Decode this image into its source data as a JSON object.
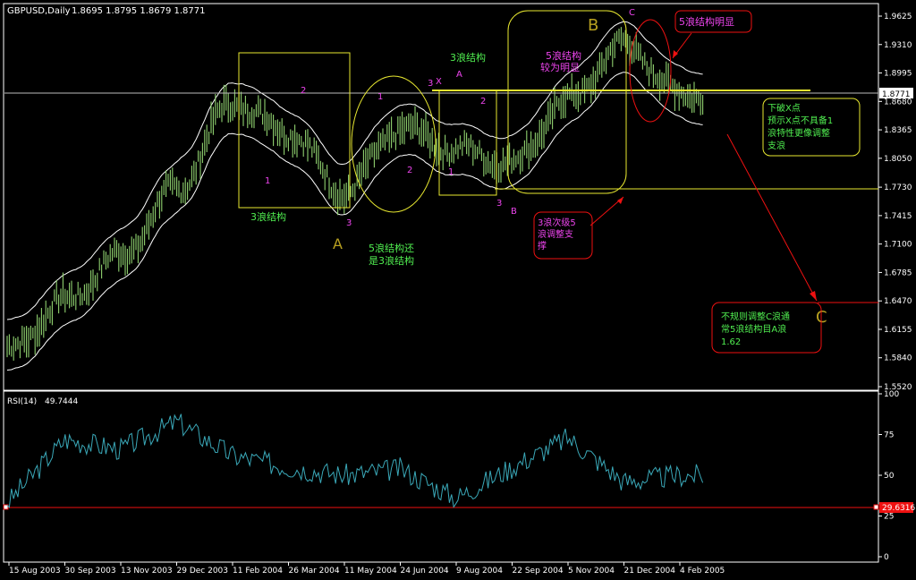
{
  "header": {
    "symbol": "GBPUSD,Daily",
    "ohlc": "1.8695 1.8795 1.8679 1.8771"
  },
  "rsi": {
    "label": "RSI(14)",
    "value": "49.7444",
    "level_label": "29.6316",
    "level": 29.6316,
    "ticks": [
      "100",
      "75",
      "50",
      "25",
      "0"
    ]
  },
  "colors": {
    "background": "#000000",
    "grid_frame": "#ffffff",
    "price_bars": "#8fd16f",
    "bands": "#ffffff",
    "annotation_yellow": "#e8e830",
    "annotation_magenta": "#ee44ee",
    "annotation_green": "#50ee50",
    "annotation_red": "#ee1111",
    "wave_letters": "#b8a020",
    "rsi_line": "#3aa8b8"
  },
  "chart_data": [
    {
      "type": "candlestick",
      "title": "GBPUSD,Daily",
      "price_axis_ticks": [
        "1.9625",
        "1.9310",
        "1.8995",
        "1.8680",
        "1.8365",
        "1.8050",
        "1.7730",
        "1.7415",
        "1.7100",
        "1.6785",
        "1.6470",
        "1.6155",
        "1.5840",
        "1.5520"
      ],
      "current_price_label": "1.8771",
      "ylim": [
        1.552,
        1.9625
      ],
      "date_axis_labels": [
        "15 Aug 2003",
        "30 Sep 2003",
        "13 Nov 2003",
        "29 Dec 2003",
        "11 Feb 2004",
        "26 Mar 2004",
        "11 May 2004",
        "24 Jun 2004",
        "9 Aug 2004",
        "22 Sep 2004",
        "5 Nov 2004",
        "21 Dec 2004",
        "4 Feb 2005"
      ],
      "series": [
        {
          "name": "close (approx.)",
          "x": [
            "15 Aug 2003",
            "30 Sep 2003",
            "13 Nov 2003",
            "29 Dec 2003",
            "11 Feb 2004",
            "26 Mar 2004",
            "11 May 2004",
            "24 Jun 2004",
            "9 Aug 2004",
            "22 Sep 2004",
            "5 Nov 2004",
            "21 Dec 2004",
            "4 Feb 2005"
          ],
          "values": [
            1.592,
            1.647,
            1.697,
            1.771,
            1.867,
            1.835,
            1.768,
            1.838,
            1.815,
            1.8,
            1.869,
            1.931,
            1.877
          ]
        }
      ],
      "horizontal_lines": [
        1.8771,
        1.881,
        1.773,
        1.647
      ]
    },
    {
      "type": "line",
      "title": "RSI(14) 49.7444",
      "ylim": [
        0,
        100
      ],
      "level_line": 29.6316,
      "series": [
        {
          "name": "RSI(14)",
          "x": [
            "15 Aug 2003",
            "30 Sep 2003",
            "13 Nov 2003",
            "29 Dec 2003",
            "11 Feb 2004",
            "26 Mar 2004",
            "11 May 2004",
            "24 Jun 2004",
            "9 Aug 2004",
            "22 Sep 2004",
            "5 Nov 2004",
            "21 Dec 2004",
            "4 Feb 2005"
          ],
          "values": [
            34,
            72,
            66,
            83,
            62,
            55,
            50,
            54,
            36,
            55,
            73,
            46,
            50
          ]
        }
      ]
    }
  ],
  "annotations": {
    "box1_label": "3浪结构",
    "box1_wave1": "1",
    "box1_wave2": "2",
    "box1_wave3": "3",
    "letter_A": "A",
    "ellipse_label_1": "5浪结构还",
    "ellipse_label_2": "是3浪结构",
    "ellipse_wave1": "1",
    "ellipse_wave2": "2",
    "ellipse_wave3": "3",
    "x_mark": "X",
    "a_mark": "A",
    "box2_top_label": "3浪结构",
    "box2_wave1": "1",
    "box2_wave2": "2",
    "box2_wave3": "3",
    "b_mark_small": "B",
    "rounded_label_1": "5浪结构",
    "rounded_label_2": "较为明显",
    "letter_B": "B",
    "c_mark": "C",
    "red_box1_label": "5浪结构明显",
    "red_box2_line1": "3浪次级5",
    "red_box2_line2": "浪调整支",
    "red_box2_line3": "撑",
    "yellow_box_line1": "下破X点",
    "yellow_box_line2": "预示X点不具备1",
    "yellow_box_line3": "浪特性更像调整",
    "yellow_box_line4": "支浪",
    "letter_C": "C",
    "red_box3_line1": "不规则调整C浪通",
    "red_box3_line2": "常5浪结构目A浪",
    "red_box3_line3": "1.62"
  }
}
